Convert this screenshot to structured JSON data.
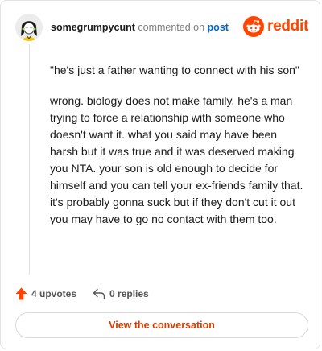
{
  "comment": {
    "username": "somegrumpycunt",
    "action_text": "commented on",
    "post_link_label": "post",
    "brand_name": "reddit",
    "paragraphs": [
      "\"he's just a father wanting to connect with his son\"",
      "wrong. biology does not make family. he's a man trying to force a relationship with someone who doesn't want it. what you said may have been harsh but it was true and it was deserved making you NTA. your son is old enough to decide for himself and you can tell your ex-friends family that. it's probably gonna suck but if they don't cut it out you may have to go no contact with them too."
    ]
  },
  "footer": {
    "upvotes_label": "4 upvotes",
    "replies_label": "0 replies",
    "cta_label": "View the conversation"
  },
  "icons": {
    "upvote": "upvote-arrow-icon",
    "reply": "reply-arrow-icon",
    "brand": "reddit-alien-icon",
    "avatar": "snoo-avatar"
  },
  "colors": {
    "brand_orange": "#ff4500",
    "link_blue": "#0a66c2",
    "cta_text": "#d93a00",
    "upvote_orange": "#ff4500"
  }
}
